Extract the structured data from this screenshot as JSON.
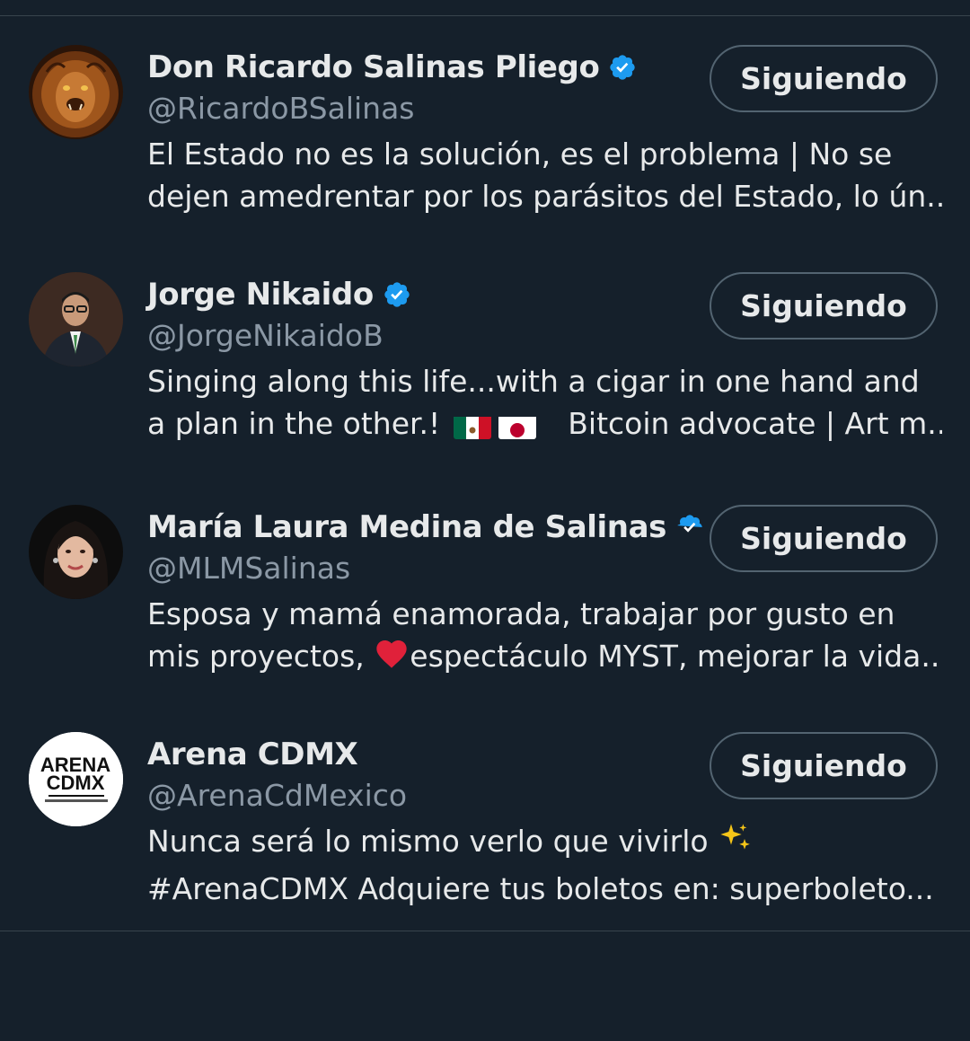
{
  "following_list": [
    {
      "display_name": "Don Ricardo Salinas Pliego",
      "verified": true,
      "handle": "@RicardoBSalinas",
      "bio_line1": "El Estado no es la solución, es el problema | No se",
      "bio_line2": "dejen amedrentar por los parásitos del Estado, lo ún...",
      "button_label": "Siguiendo",
      "avatar_icon": "lion-avatar"
    },
    {
      "display_name": "Jorge Nikaido",
      "verified": true,
      "handle": "@JorgeNikaidoB",
      "bio_line1": "Singing along this life...with a cigar in one hand and",
      "bio_line2_a": "a plan in the other.!",
      "bio_line2_b": "Bitcoin advocate | Art m...",
      "button_label": "Siguiendo",
      "avatar_icon": "man-in-suit-avatar"
    },
    {
      "display_name": "María Laura Medina de Salinas",
      "verified": true,
      "handle": "@MLMSalinas",
      "bio_line1": "Esposa y mamá enamorada, trabajar por gusto en",
      "bio_line2_a": "mis proyectos,",
      "bio_line2_b": "espectáculo MYST, mejorar la vida...",
      "button_label": "Siguiendo",
      "avatar_icon": "woman-portrait-avatar"
    },
    {
      "display_name": "Arena CDMX",
      "verified": false,
      "handle": "@ArenaCdMexico",
      "bio_line1": "Nunca será lo mismo verlo que vivirlo",
      "bio_line2": "#ArenaCDMX Adquiere tus boletos en: superboleto...",
      "button_label": "Siguiendo",
      "avatar_icon": "arena-cdmx-logo",
      "logo_text_top": "ARENA",
      "logo_text_bottom": "CDMX"
    }
  ],
  "colors": {
    "background": "#15202b",
    "text_primary": "#e7e9ea",
    "text_secondary": "#8b98a5",
    "verified_blue": "#1d9bf0",
    "button_border": "#536471",
    "divider": "#38444d"
  }
}
